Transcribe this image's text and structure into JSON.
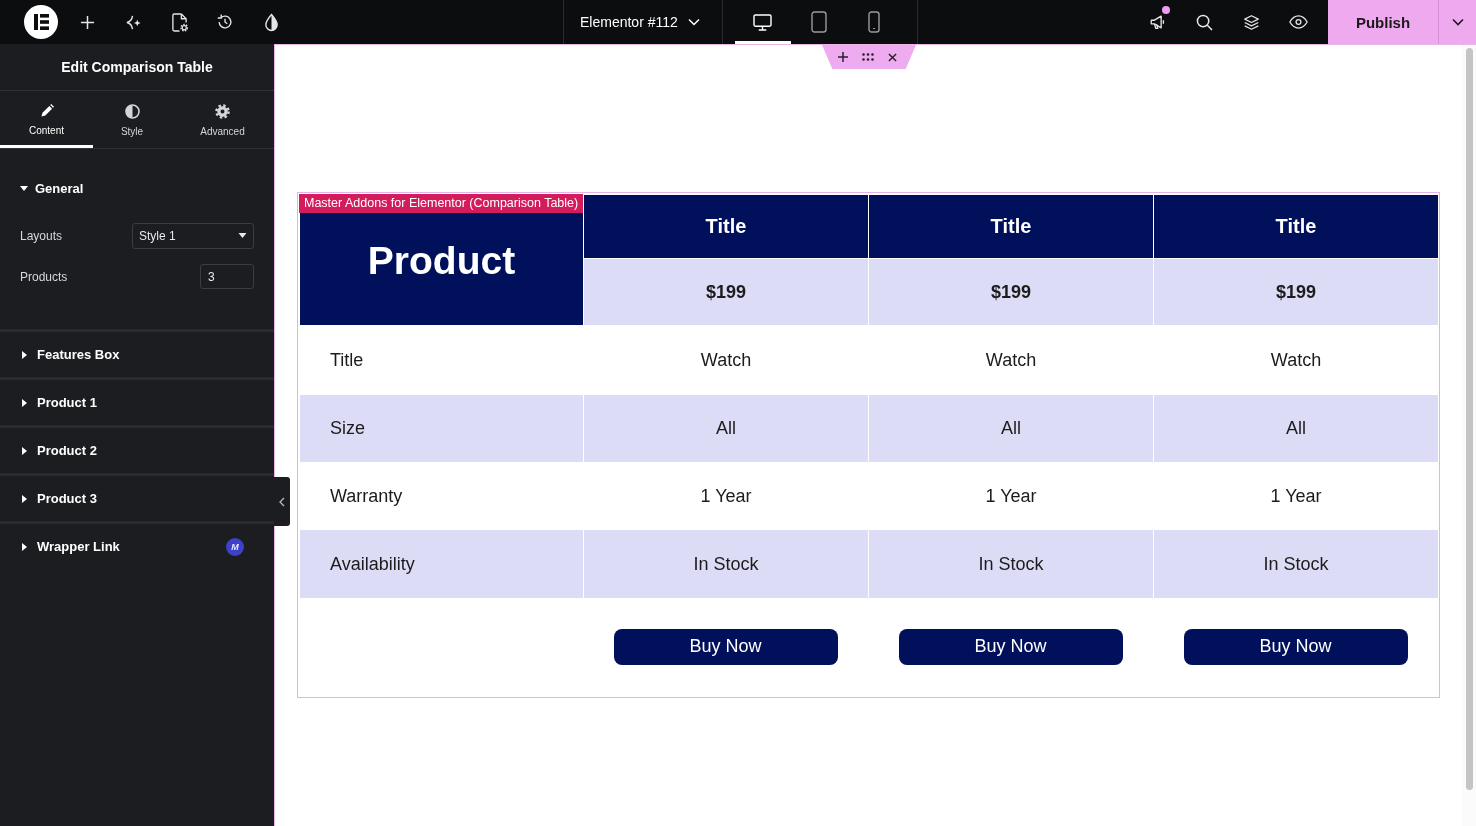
{
  "top_bar": {
    "document_title": "Elementor #112",
    "devices": [
      {
        "kind": "desktop",
        "selected": true
      },
      {
        "kind": "tablet",
        "selected": false
      },
      {
        "kind": "mobile",
        "selected": false
      }
    ],
    "announcements_unread": true,
    "publish_label": "Publish"
  },
  "panel": {
    "title": "Edit Comparison Table",
    "tabs": [
      {
        "label": "Content",
        "kind": "pencil",
        "selected": true
      },
      {
        "label": "Style",
        "kind": "contrast",
        "selected": false
      },
      {
        "label": "Advanced",
        "kind": "gear",
        "selected": false
      }
    ],
    "sections": [
      {
        "title": "General",
        "expanded": true,
        "fields": [
          {
            "label": "Layouts",
            "kind": "select",
            "value": "Style 1"
          },
          {
            "label": "Products",
            "kind": "number",
            "value": "3"
          }
        ]
      },
      {
        "title": "Features Box",
        "expanded": false
      },
      {
        "title": "Product 1",
        "expanded": false
      },
      {
        "title": "Product 2",
        "expanded": false
      },
      {
        "title": "Product 3",
        "expanded": false
      },
      {
        "title": "Wrapper Link",
        "expanded": false,
        "badge": "M"
      }
    ]
  },
  "canvas": {
    "widget_label": "Master Addons for Elementor (Comparison Table)",
    "comparison_table": {
      "corner_label": "Product",
      "products": [
        {
          "title": "Title",
          "price": "$199",
          "button": "Buy Now"
        },
        {
          "title": "Title",
          "price": "$199",
          "button": "Buy Now"
        },
        {
          "title": "Title",
          "price": "$199",
          "button": "Buy Now"
        }
      ],
      "rows": [
        {
          "label": "Title",
          "cells": [
            "Watch",
            "Watch",
            "Watch"
          ]
        },
        {
          "label": "Size",
          "cells": [
            "All",
            "All",
            "All"
          ]
        },
        {
          "label": "Warranty",
          "cells": [
            "1 Year",
            "1 Year",
            "1 Year"
          ]
        },
        {
          "label": "Availability",
          "cells": [
            "In Stock",
            "In Stock",
            "In Stock"
          ]
        }
      ]
    }
  }
}
